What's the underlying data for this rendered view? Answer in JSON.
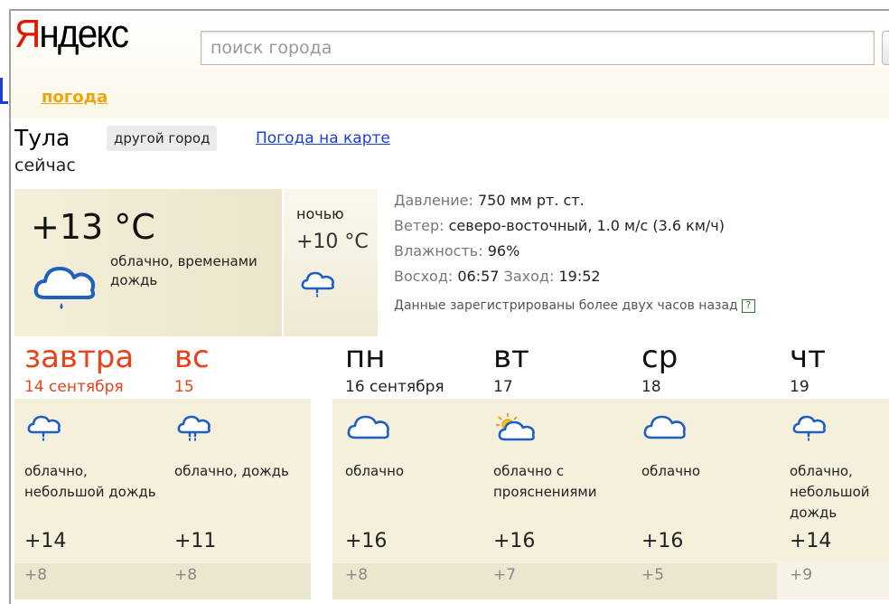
{
  "header": {
    "logo": "Яндекс",
    "search_placeholder": "поиск города",
    "service": "погода"
  },
  "location": {
    "city": "Тула",
    "other_city_button": "другой город",
    "map_link": "Погода на карте",
    "now_label": "сейчас"
  },
  "current": {
    "temp": "+13 °C",
    "description": "облачно, временами дождь",
    "icon": "cloud-rain-icon",
    "night_label": "ночью",
    "night_temp": "+10 °C",
    "night_icon": "small-cloud-rain-icon"
  },
  "details": {
    "pressure_label": "Давление:",
    "pressure_value": "750 мм рт. ст.",
    "wind_label": "Ветер:",
    "wind_value": "северо-восточный, 1.0 м/с (3.6 км/ч)",
    "humidity_label": "Влажность:",
    "humidity_value": "96%",
    "sunrise_label": "Восход:",
    "sunrise_value": "06:57",
    "sunset_label": "Заход:",
    "sunset_value": "19:52",
    "note": "Данные зарегистрированы более двух часов назад",
    "help": "?"
  },
  "forecast": [
    {
      "name": "завтра",
      "date": "14 сентября",
      "icon": "cloud-rain-icon",
      "desc": "облачно, небольшой дождь",
      "hi": "+14",
      "lo": "+8",
      "weekend": true
    },
    {
      "name": "вс",
      "date": "15",
      "icon": "cloud-rain-icon",
      "desc": "облачно, дождь",
      "hi": "+11",
      "lo": "+8",
      "weekend": true
    },
    {
      "name": "пн",
      "date": "16 сентября",
      "icon": "cloud-icon",
      "desc": "облачно",
      "hi": "+16",
      "lo": "+8",
      "weekend": false
    },
    {
      "name": "вт",
      "date": "17",
      "icon": "sun-cloud-icon",
      "desc": "облачно с прояснениями",
      "hi": "+16",
      "lo": "+7",
      "weekend": false
    },
    {
      "name": "ср",
      "date": "18",
      "icon": "cloud-icon",
      "desc": "облачно",
      "hi": "+16",
      "lo": "+5",
      "weekend": false
    },
    {
      "name": "чт",
      "date": "19",
      "icon": "cloud-rain-icon",
      "desc": "облачно, небольшой дождь",
      "hi": "+14",
      "lo": "+9",
      "weekend": false
    }
  ],
  "colors": {
    "logo_red": "#e61400",
    "weekend_red": "#e8421c",
    "link_blue": "#1a3dd6",
    "service_orange": "#f0a30a",
    "icon_blue": "#1f5fbf"
  }
}
